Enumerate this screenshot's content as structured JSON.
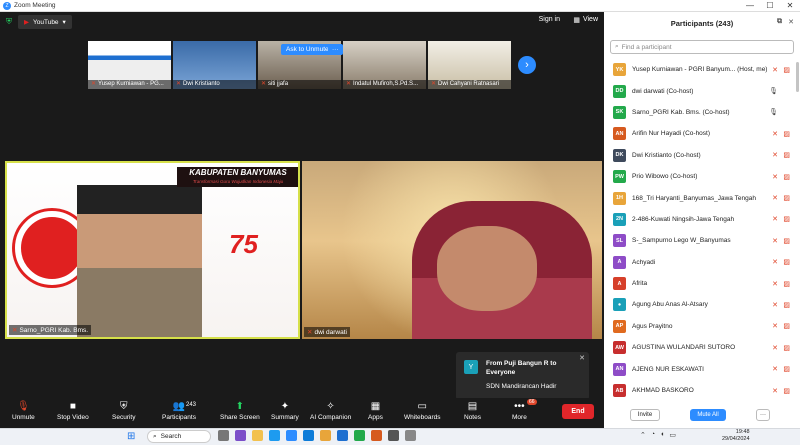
{
  "window": {
    "title": "Zoom Meeting",
    "minimize": "—",
    "maximize": "☐",
    "close": "✕"
  },
  "topbar": {
    "stream_label": "YouTube",
    "sign_in": "Sign in",
    "view": "View"
  },
  "thumbnails": [
    {
      "name": "Yusep Kurniawan - PG..."
    },
    {
      "name": "Dwi Kristianto"
    },
    {
      "name": "siti jjafa"
    },
    {
      "name": "Indatul Mufiroh,S.Pd.S..."
    },
    {
      "name": "Dwi Cahyani Ratnasari"
    }
  ],
  "ask_to_unmute": "Ask to Unmute",
  "ask_more": "···",
  "main_videos": [
    {
      "name": "Sarno_PGRI Kab. Bms.",
      "banner_title": "KABUPATEN BANYUMAS",
      "banner_sub": "Transformasi Guru Wujudkan Indonesia Maju"
    },
    {
      "name": "dwi darwati"
    }
  ],
  "chat": {
    "avatar": "Y",
    "header": "From Puji Bangun R to Everyone",
    "message": "SDN Mandirancan Hadir",
    "close": "✕"
  },
  "toolbar": {
    "unmute": "Unmute",
    "stop_video": "Stop Video",
    "security": "Security",
    "participants": "Participants",
    "participants_count": "243",
    "share_screen": "Share Screen",
    "summary": "Summary",
    "ai_companion": "AI Companion",
    "apps": "Apps",
    "whiteboards": "Whiteboards",
    "notes": "Notes",
    "more": "More",
    "more_badge": "66",
    "end": "End"
  },
  "panel": {
    "title": "Participants (243)",
    "search_placeholder": "Find a participant",
    "invite": "Invite",
    "mute_all": "Mute All",
    "more": "···",
    "participants": [
      {
        "initials": "YK",
        "name": "Yusep Kurniawan - PGRI Banyum... (Host, me)",
        "color": "#e8a53a"
      },
      {
        "initials": "DD",
        "name": "dwi darwati (Co-host)",
        "color": "#23a94b"
      },
      {
        "initials": "SK",
        "name": "Sarno_PGRI Kab. Bms. (Co-host)",
        "color": "#23a94b"
      },
      {
        "initials": "AN",
        "name": "Arifin Nur Hayadi (Co-host)",
        "color": "#d65a1f"
      },
      {
        "initials": "DK",
        "name": "Dwi Kristianto (Co-host)",
        "color": "#3e4a5c"
      },
      {
        "initials": "PW",
        "name": "Prio Wibowo (Co-host)",
        "color": "#23a94b"
      },
      {
        "initials": "1H",
        "name": "168_Tri Haryanti_Banyumas_Jawa Tengah",
        "color": "#e8a53a"
      },
      {
        "initials": "2N",
        "name": "2-486-Kuwati Ningsih-Jawa Tengah",
        "color": "#1aa0b8"
      },
      {
        "initials": "SL",
        "name": "S-_Sampurno Lego W_Banyumas",
        "color": "#8e4cc7"
      },
      {
        "initials": "A",
        "name": "Achyadi",
        "color": "#8e4cc7"
      },
      {
        "initials": "A",
        "name": "Afrita",
        "color": "#d6402a"
      },
      {
        "initials": "●",
        "name": "Agung Abu Anas Al-Atsary",
        "color": "#1aa0b8"
      },
      {
        "initials": "AP",
        "name": "Agus Prayitno",
        "color": "#e06a1f"
      },
      {
        "initials": "AW",
        "name": "AGUSTINA WULANDARI SUTORO",
        "color": "#c72e2e"
      },
      {
        "initials": "AN",
        "name": "AJENG NUR ESKAWATI",
        "color": "#8e4cc7"
      },
      {
        "initials": "AB",
        "name": "AKHMAD BASKORO",
        "color": "#c72e2e"
      }
    ]
  },
  "taskbar": {
    "search": "Search",
    "time": "19:48",
    "date": "29/04/2024"
  }
}
